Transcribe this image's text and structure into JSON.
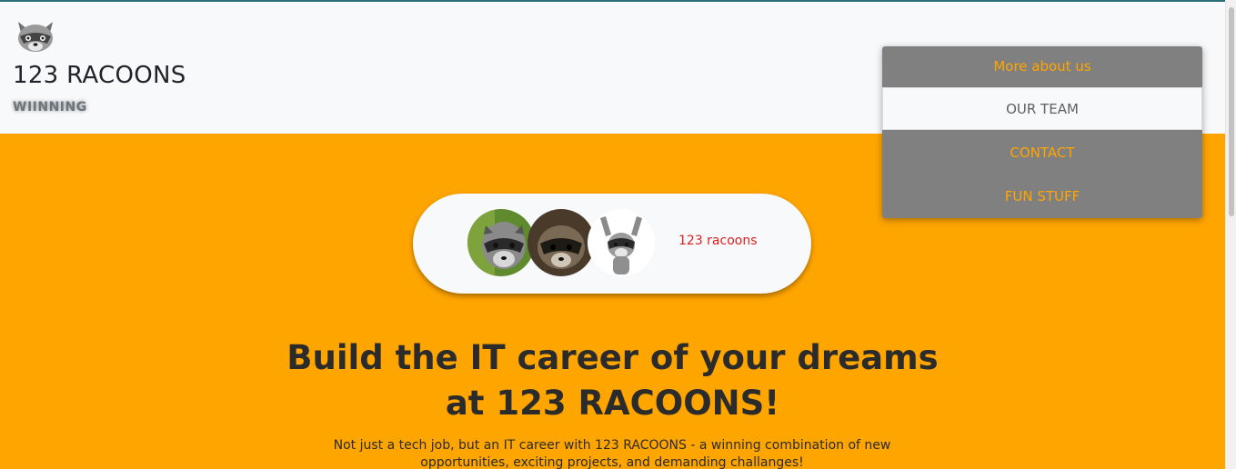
{
  "brand": {
    "title": "123 RACOONS",
    "tagline": "WIINNING",
    "logo_icon": "raccoon-icon"
  },
  "nav": {
    "toggle_label": "More about us",
    "items": [
      {
        "label": "OUR TEAM",
        "active": true
      },
      {
        "label": "CONTACT",
        "active": false
      },
      {
        "label": "FUN STUFF",
        "active": false
      }
    ]
  },
  "hero": {
    "pill_label": "123 racoons",
    "avatars": [
      "raccoon-photo-1",
      "raccoon-photo-2",
      "raccoon-photo-3"
    ],
    "headline_line1": "Build the IT career of your dreams",
    "headline_line2": "at 123 RACOONS!",
    "subtext_line1": "Not just a tech job, but an IT career with 123 RACOONS - a winning combination of new",
    "subtext_line2": "opportunities, exciting projects, and demanding challanges!"
  },
  "colors": {
    "accent": "#ffa500",
    "header_bg": "#f8f9fa",
    "dropdown_bg": "#808080",
    "pill_label": "#dc1f1f",
    "text_dark": "#2b2b2b"
  }
}
